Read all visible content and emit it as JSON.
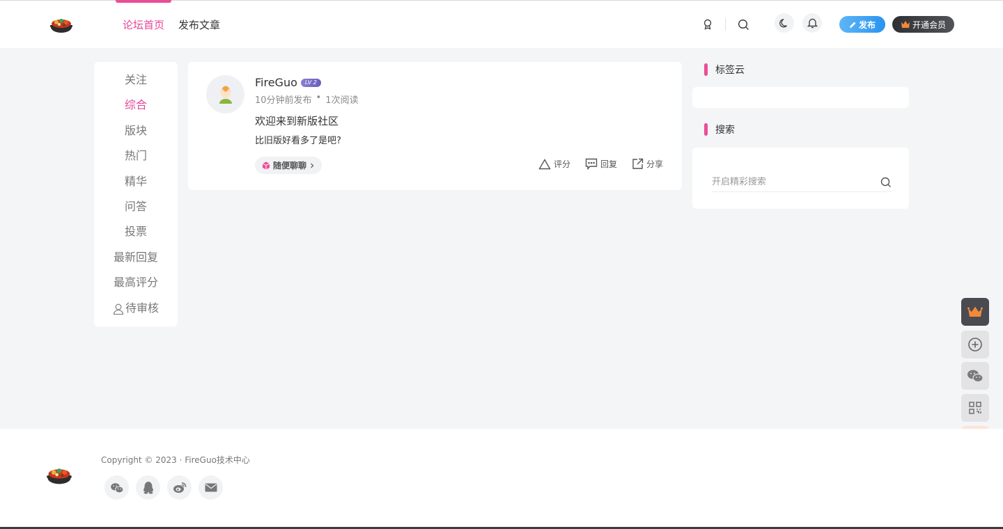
{
  "header": {
    "nav": [
      {
        "label": "论坛首页",
        "active": true
      },
      {
        "label": "发布文章",
        "active": false
      }
    ],
    "publish_label": "发布",
    "vip_label": "开通会员"
  },
  "leftmenu": {
    "items": [
      {
        "label": "关注",
        "active": false
      },
      {
        "label": "综合",
        "active": true
      },
      {
        "label": "版块",
        "active": false
      },
      {
        "label": "热门",
        "active": false
      },
      {
        "label": "精华",
        "active": false
      },
      {
        "label": "问答",
        "active": false
      },
      {
        "label": "投票",
        "active": false
      },
      {
        "label": "最新回复",
        "active": false
      },
      {
        "label": "最高评分",
        "active": false
      },
      {
        "label": "待审核",
        "active": false
      }
    ]
  },
  "post": {
    "author": "FireGuo",
    "level": "LV 2",
    "time": "10分钟前发布",
    "dot": "•",
    "reads": "1次阅读",
    "title": "欢迎来到新版社区",
    "excerpt": "比旧版好看多了是吧?",
    "tag": "随便聊聊",
    "actions": {
      "rate": "评分",
      "reply": "回复",
      "share": "分享"
    }
  },
  "sidebar": {
    "tagcloud_title": "标签云",
    "search_title": "搜索",
    "search_placeholder": "开启精彩搜索"
  },
  "footer": {
    "copyright": "Copyright © 2023 · FireGuo技术中心"
  },
  "colors": {
    "accent": "#e64597",
    "publish": "#2a93ef"
  }
}
